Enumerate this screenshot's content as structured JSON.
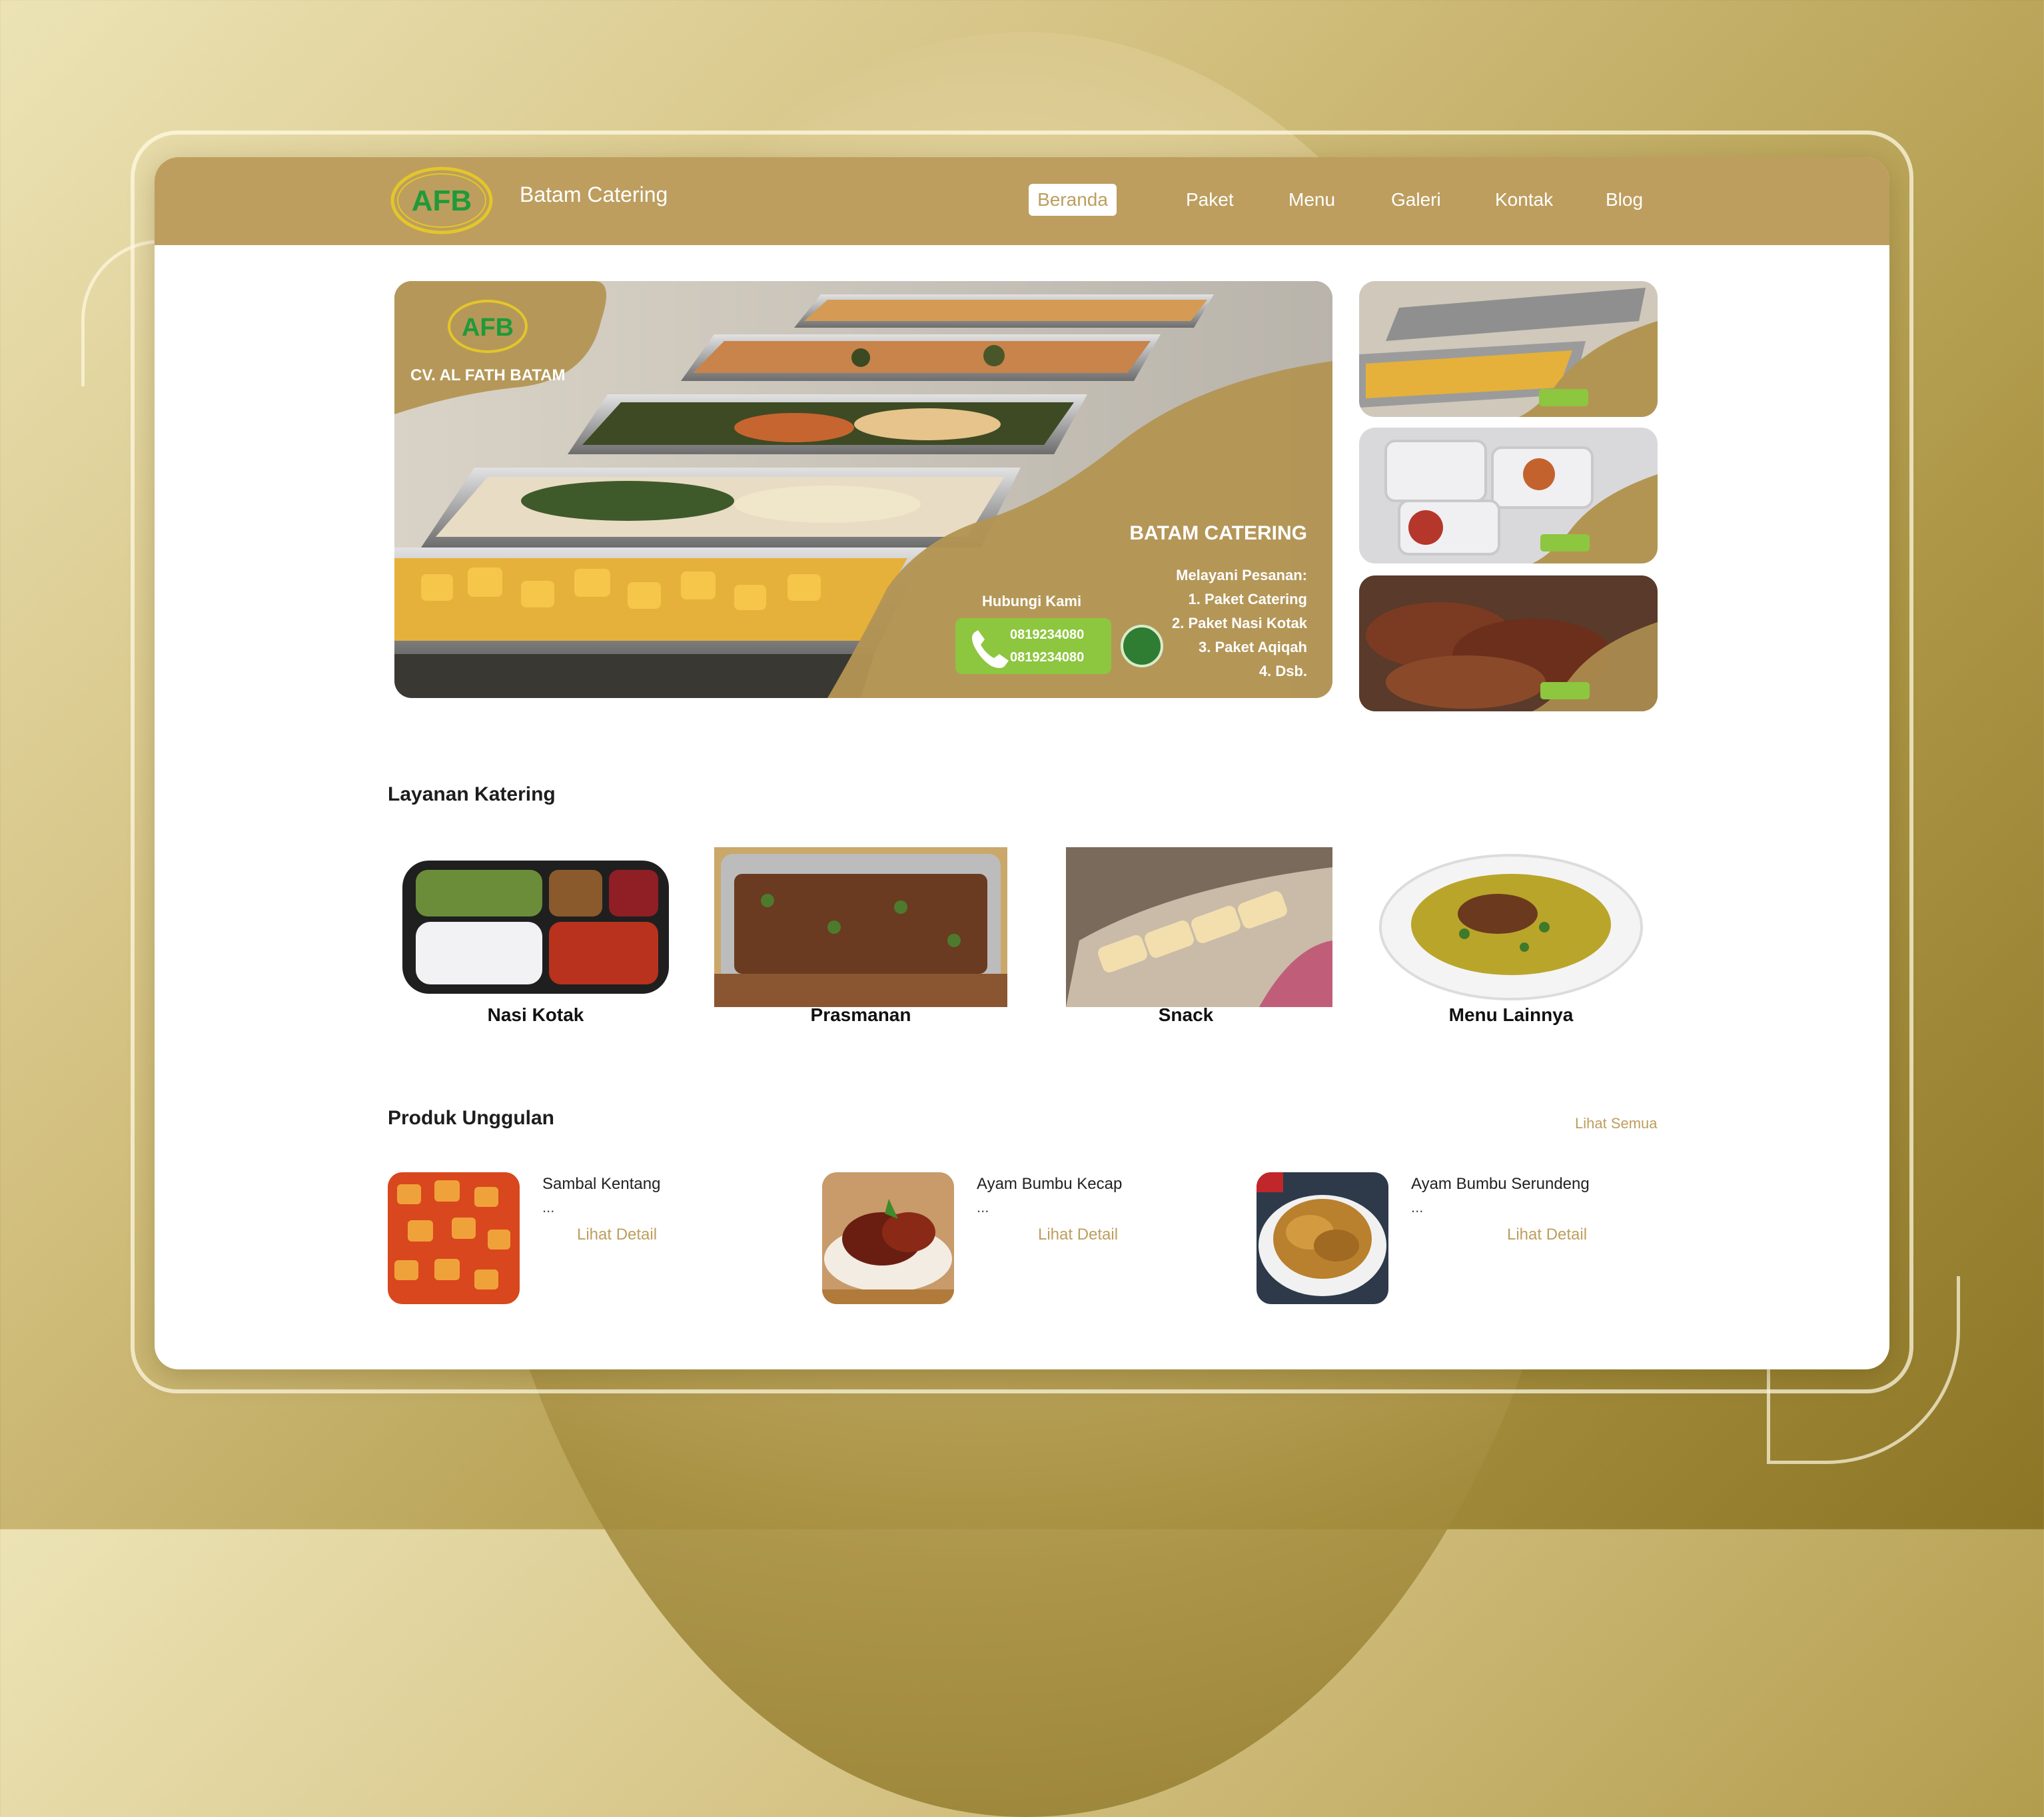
{
  "header": {
    "logo_text": "AFB",
    "brand": "Batam Catering",
    "nav": [
      "Beranda",
      "Paket",
      "Menu",
      "Galeri",
      "Kontak",
      "Blog"
    ]
  },
  "hero": {
    "company": "CV. AL FATH BATAM",
    "title": "BATAM CATERING",
    "services_heading": "Melayani Pesanan:",
    "services": [
      "1. Paket Catering",
      "2. Paket Nasi Kotak",
      "3. Paket Aqiqah",
      "4. Dsb."
    ],
    "contact_label": "Hubungi Kami",
    "phones": [
      "0819234080",
      "0819234080"
    ]
  },
  "layanan": {
    "title": "Layanan Katering",
    "items": [
      "Nasi Kotak",
      "Prasmanan",
      "Snack",
      "Menu Lainnya"
    ]
  },
  "produk": {
    "title": "Produk Unggulan",
    "see_all": "Lihat Semua",
    "items": [
      {
        "name": "Sambal Kentang",
        "desc": "...",
        "link": "Lihat Detail"
      },
      {
        "name": "Ayam Bumbu Kecap",
        "desc": "...",
        "link": "Lihat Detail"
      },
      {
        "name": "Ayam Bumbu Serundeng",
        "desc": "...",
        "link": "Lihat Detail"
      }
    ]
  },
  "colors": {
    "accent": "#bd9e5e",
    "logo_green": "#1f9a3a",
    "logo_ring": "#e3c62a",
    "phone_green": "#8dc63f"
  }
}
